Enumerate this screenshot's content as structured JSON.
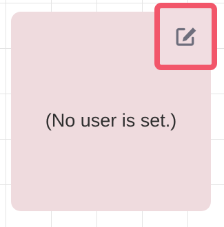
{
  "card": {
    "message": "(No user is set.)",
    "background_color": "#efdbde"
  },
  "edit_button": {
    "icon": "edit-icon",
    "highlight_color": "#f2566a",
    "icon_color": "#6e6e7c"
  }
}
